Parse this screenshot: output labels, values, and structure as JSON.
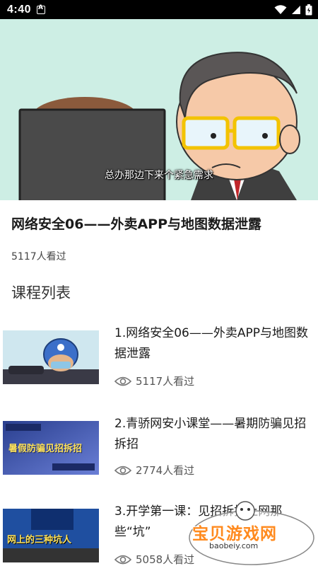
{
  "status_bar": {
    "time": "4:40"
  },
  "video": {
    "subtitle": "总办那边下来个紧急需求"
  },
  "header": {
    "title": "网络安全06——外卖APP与地图数据泄露",
    "views": "5117人看过"
  },
  "section": {
    "title": "课程列表"
  },
  "courses": [
    {
      "title": "1.网络安全06——外卖APP与地图数据泄露",
      "views": "5117人看过",
      "thumb_text": ""
    },
    {
      "title": "2.青骄网安小课堂——暑期防骗见招拆招",
      "views": "2774人看过",
      "thumb_text": "暑假防骗见招拆招"
    },
    {
      "title": "3.开学第一课：见招拆招上网那些“坑”",
      "views": "5058人看过",
      "thumb_text": "网上的三种坑人"
    }
  ],
  "watermark": {
    "text": "宝贝游戏网",
    "url": "baobeiy.com"
  },
  "colors": {
    "accent_orange": "#ff8a1e",
    "video_bg": "#cdeee4"
  }
}
